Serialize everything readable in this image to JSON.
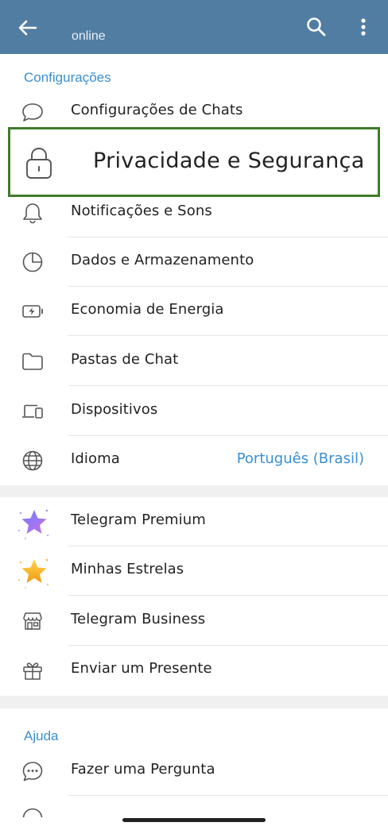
{
  "header": {
    "status": "online",
    "bg_color": "#527da3"
  },
  "settings": {
    "section_title": "Configurações",
    "items": [
      {
        "label": "Configurações de Chats",
        "icon": "chat-bubble-icon"
      },
      {
        "label": "Privacidade e Segurança",
        "icon": "lock-icon",
        "highlighted": true
      },
      {
        "label": "Notificações e Sons",
        "icon": "bell-icon"
      },
      {
        "label": "Dados e Armazenamento",
        "icon": "pie-chart-icon"
      },
      {
        "label": "Economia de Energia",
        "icon": "battery-icon"
      },
      {
        "label": "Pastas de Chat",
        "icon": "folder-icon"
      },
      {
        "label": "Dispositivos",
        "icon": "devices-icon"
      },
      {
        "label": "Idioma",
        "icon": "globe-icon",
        "value": "Português (Brasil)"
      }
    ]
  },
  "premium": {
    "items": [
      {
        "label": "Telegram Premium",
        "icon": "premium-star-icon"
      },
      {
        "label": "Minhas Estrelas",
        "icon": "gold-star-icon"
      },
      {
        "label": "Telegram Business",
        "icon": "store-icon"
      },
      {
        "label": "Enviar um Presente",
        "icon": "gift-icon"
      }
    ]
  },
  "help": {
    "section_title": "Ajuda",
    "items": [
      {
        "label": "Fazer uma Pergunta",
        "icon": "question-chat-icon"
      }
    ]
  },
  "colors": {
    "accent": "#3a8fd0",
    "highlight_border": "#3e7c2a"
  }
}
